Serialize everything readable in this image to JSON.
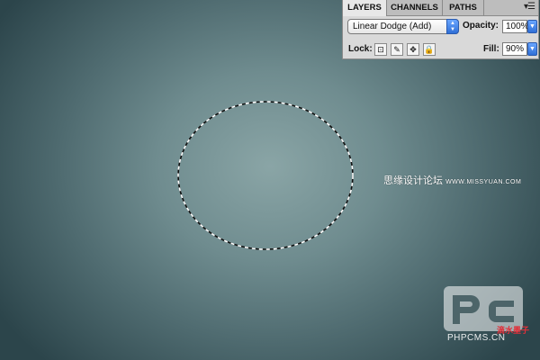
{
  "layers_panel": {
    "tabs": [
      {
        "label": "LAYERS",
        "active": true
      },
      {
        "label": "CHANNELS",
        "active": false
      },
      {
        "label": "PATHS",
        "active": false
      }
    ],
    "menu_icon": "panel-menu-icon",
    "blend_mode": "Linear Dodge (Add)",
    "opacity_label": "Opacity:",
    "opacity_value": "100%",
    "lock_label": "Lock:",
    "fill_label": "Fill:",
    "fill_value": "90%",
    "lock_icons": [
      "lock-transparent-icon",
      "lock-paint-icon",
      "lock-move-icon",
      "lock-all-icon"
    ]
  },
  "canvas": {
    "selection": "elliptical-marquee"
  },
  "watermark": {
    "site_cn": "思缘设计论坛",
    "site_url": "WWW.MISSYUAN.COM",
    "logo_url": "PHPCMS.CN",
    "logo_red": "滴水墨子"
  },
  "colors": {
    "accent_blue": "#2f6fd6",
    "watermark_red": "#e0303a"
  }
}
